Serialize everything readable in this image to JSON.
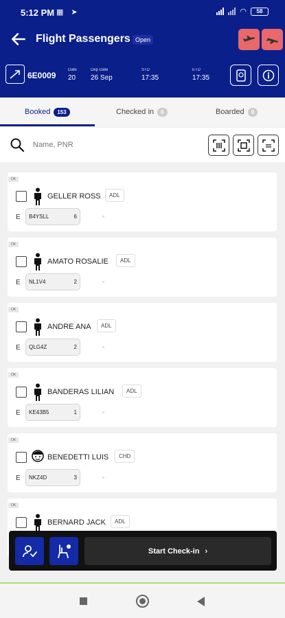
{
  "status_bar": {
    "time": "5:12 PM",
    "battery": "58"
  },
  "header": {
    "title": "Flight Passengers",
    "status": "Open"
  },
  "flight": {
    "number": "6E0009",
    "fields": [
      {
        "label": "Date",
        "value": "20"
      },
      {
        "label": "Dep Date",
        "value": "26 Sep"
      },
      {
        "label": "STD",
        "value": "17:35"
      },
      {
        "label": "ETD",
        "value": "17:35"
      }
    ]
  },
  "tabs": [
    {
      "label": "Booked",
      "count": "153"
    },
    {
      "label": "Checked in",
      "count": "0"
    },
    {
      "label": "Boarded",
      "count": "0"
    }
  ],
  "search": {
    "placeholder": "Name, PNR"
  },
  "passengers": [
    {
      "status": "OK",
      "name": "GELLER ROSS",
      "type": "ADL",
      "class": "E",
      "pnr": "B4YSLL",
      "count": "6",
      "icon": "adult-icon"
    },
    {
      "status": "OK",
      "name": "AMATO ROSALIE",
      "type": "ADL",
      "class": "E",
      "pnr": "NL1V4",
      "count": "2",
      "icon": "adult-icon"
    },
    {
      "status": "OK",
      "name": "ANDRE ANA",
      "type": "ADL",
      "class": "E",
      "pnr": "QLG4Z",
      "count": "2",
      "icon": "adult-icon"
    },
    {
      "status": "OK",
      "name": "BANDERAS LILIAN",
      "type": "ADL",
      "class": "E",
      "pnr": "KE43B5",
      "count": "1",
      "icon": "adult-icon"
    },
    {
      "status": "OK",
      "name": "BENEDETTI LUIS",
      "type": "CHD",
      "class": "E",
      "pnr": "NKZ4D",
      "count": "3",
      "icon": "child-icon"
    },
    {
      "status": "OK",
      "name": "BERNARD JACK",
      "type": "ADL",
      "class": "E",
      "pnr": "",
      "count": "",
      "icon": "adult-icon"
    }
  ],
  "actions": {
    "checkin_label": "Start Check-in"
  },
  "colors": {
    "brand": "#0b1f8a",
    "header_button": "#e9686a",
    "action_button": "#142aa6"
  }
}
